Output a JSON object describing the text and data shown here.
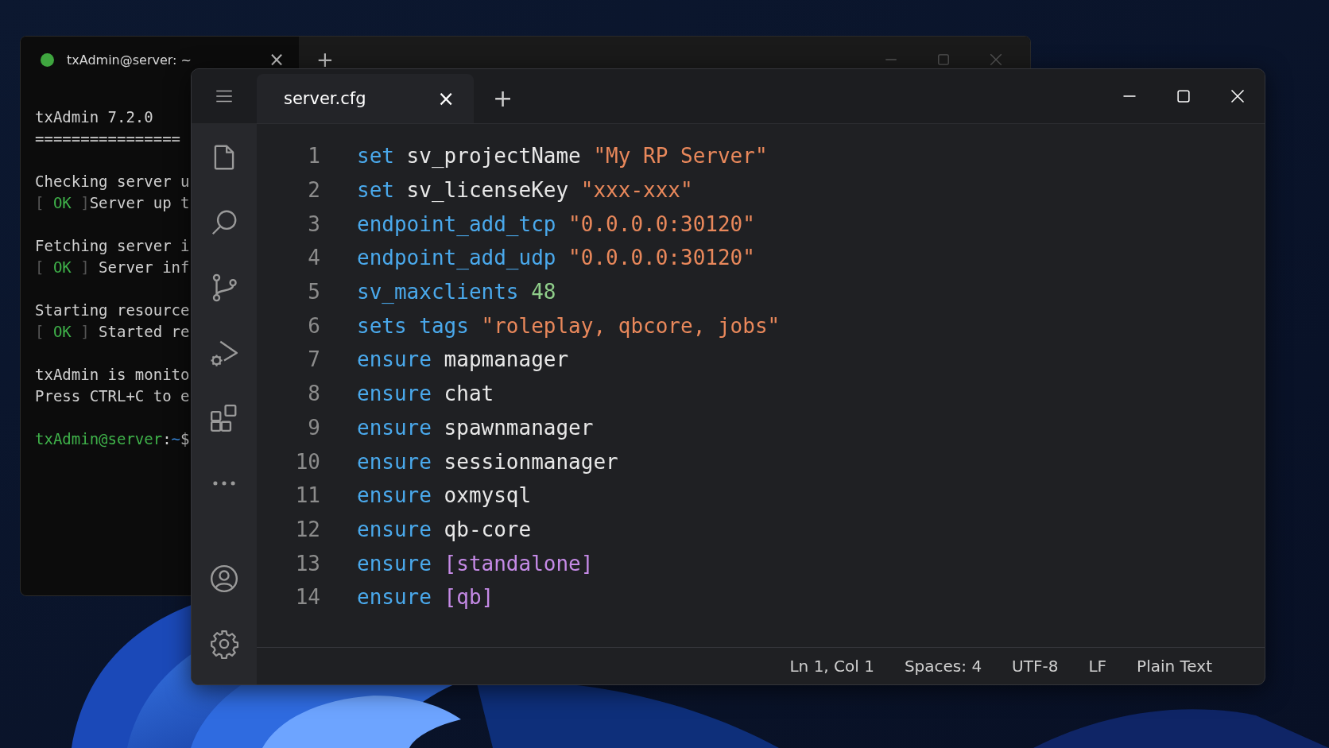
{
  "terminal": {
    "title": "txAdmin@server: ~",
    "tab_close": "×",
    "new_tab": "+",
    "blocks": [
      {
        "lines": [
          [
            {
              "kind": "plain",
              "text": "txAdmin 7.2.0"
            }
          ],
          [
            {
              "kind": "plain",
              "text": "================"
            }
          ]
        ]
      },
      {
        "lines": [
          [
            {
              "kind": "plain",
              "text": "Checking server u"
            }
          ],
          [
            {
              "kind": "dim",
              "text": "[ "
            },
            {
              "kind": "ok",
              "text": "OK"
            },
            {
              "kind": "dim",
              "text": " ]"
            },
            {
              "kind": "plain",
              "text": "Server up t"
            }
          ]
        ]
      },
      {
        "lines": [
          [
            {
              "kind": "plain",
              "text": "Fetching server i"
            }
          ],
          [
            {
              "kind": "dim",
              "text": "[ "
            },
            {
              "kind": "ok",
              "text": "OK"
            },
            {
              "kind": "dim",
              "text": " ] "
            },
            {
              "kind": "plain",
              "text": "Server inf"
            }
          ]
        ]
      },
      {
        "lines": [
          [
            {
              "kind": "plain",
              "text": "Starting resource"
            }
          ],
          [
            {
              "kind": "dim",
              "text": "[ "
            },
            {
              "kind": "ok",
              "text": "OK"
            },
            {
              "kind": "dim",
              "text": " ] "
            },
            {
              "kind": "plain",
              "text": "Started re"
            }
          ]
        ]
      },
      {
        "lines": [
          [
            {
              "kind": "plain",
              "text": "txAdmin is monito"
            }
          ],
          [
            {
              "kind": "plain",
              "text": "Press CTRL+C to e"
            }
          ]
        ]
      },
      {
        "lines": [
          [
            {
              "kind": "user",
              "text": "txAdmin@server"
            },
            {
              "kind": "plain",
              "text": ":"
            },
            {
              "kind": "path",
              "text": "~"
            },
            {
              "kind": "plain",
              "text": "$"
            }
          ]
        ]
      }
    ]
  },
  "editor": {
    "tab": {
      "label": "server.cfg",
      "close": "×",
      "selected": true
    },
    "new_tab": "+",
    "lines": [
      {
        "n": "1",
        "tokens": [
          {
            "kind": "keyword",
            "text": "set"
          },
          {
            "kind": "plain",
            "text": " sv_projectName "
          },
          {
            "kind": "string",
            "text": "\"My RP Server\""
          }
        ]
      },
      {
        "n": "2",
        "tokens": [
          {
            "kind": "keyword",
            "text": "set"
          },
          {
            "kind": "plain",
            "text": " sv_licenseKey "
          },
          {
            "kind": "string",
            "text": "\"xxx-xxx\""
          }
        ]
      },
      {
        "n": "3",
        "tokens": [
          {
            "kind": "keyword",
            "text": "endpoint_add_tcp "
          },
          {
            "kind": "string",
            "text": "\"0.0.0.0:30120\""
          }
        ]
      },
      {
        "n": "4",
        "tokens": [
          {
            "kind": "keyword",
            "text": "endpoint_add_udp "
          },
          {
            "kind": "string",
            "text": "\"0.0.0.0:30120\""
          }
        ]
      },
      {
        "n": "5",
        "tokens": [
          {
            "kind": "keyword",
            "text": "sv_maxclients "
          },
          {
            "kind": "number",
            "text": "48"
          }
        ]
      },
      {
        "n": "6",
        "tokens": [
          {
            "kind": "keyword",
            "text": "sets tags "
          },
          {
            "kind": "string",
            "text": "\"roleplay, qbcore, jobs\""
          }
        ]
      },
      {
        "n": "7",
        "tokens": [
          {
            "kind": "keyword",
            "text": "ensure"
          },
          {
            "kind": "plain",
            "text": " mapmanager"
          }
        ]
      },
      {
        "n": "8",
        "tokens": [
          {
            "kind": "keyword",
            "text": "ensure"
          },
          {
            "kind": "plain",
            "text": " chat"
          }
        ]
      },
      {
        "n": "9",
        "tokens": [
          {
            "kind": "keyword",
            "text": "ensure"
          },
          {
            "kind": "plain",
            "text": " spawnmanager"
          }
        ]
      },
      {
        "n": "10",
        "tokens": [
          {
            "kind": "keyword",
            "text": "ensure"
          },
          {
            "kind": "plain",
            "text": " sessionmanager"
          }
        ]
      },
      {
        "n": "11",
        "tokens": [
          {
            "kind": "keyword",
            "text": "ensure"
          },
          {
            "kind": "plain",
            "text": " oxmysql"
          }
        ]
      },
      {
        "n": "12",
        "tokens": [
          {
            "kind": "keyword",
            "text": "ensure"
          },
          {
            "kind": "plain",
            "text": " qb-core"
          }
        ]
      },
      {
        "n": "13",
        "tokens": [
          {
            "kind": "keyword",
            "text": "ensure "
          },
          {
            "kind": "bracket",
            "text": "[standalone]"
          }
        ]
      },
      {
        "n": "14",
        "tokens": [
          {
            "kind": "keyword",
            "text": "ensure "
          },
          {
            "kind": "bracket",
            "text": "[qb]"
          }
        ]
      }
    ],
    "status_bar": [
      "Ln 1, Col 1",
      "Spaces: 4",
      "UTF-8",
      "LF",
      "Plain Text"
    ]
  }
}
